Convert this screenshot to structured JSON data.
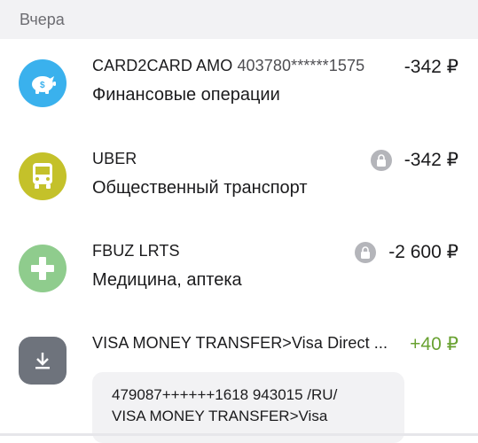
{
  "date_header": "Вчера",
  "colors": {
    "finance": "#3ab1ed",
    "transport": "#c4c12a",
    "medicine": "#8fcc8d",
    "transfer": "#6e737c",
    "positive": "#69a232"
  },
  "transactions": [
    {
      "merchant": "CARD2CARD AMO",
      "card": "403780******1575",
      "category": "Финансовые операции",
      "amount": "-342 ₽",
      "icon": "piggy-bank-icon",
      "locked": false
    },
    {
      "merchant": "UBER",
      "category": "Общественный транспорт",
      "amount": "-342 ₽",
      "icon": "bus-icon",
      "locked": true
    },
    {
      "merchant": "FBUZ LRTS",
      "category": "Медицина, аптека",
      "amount": "-2 600 ₽",
      "icon": "plus-icon",
      "locked": true
    },
    {
      "merchant": "VISA MONEY TRANSFER>Visa Direct ...",
      "amount": "+40 ₽",
      "icon": "download-icon",
      "details_line1": "479087++++++1618 943015 /RU/",
      "details_line2": "VISA MONEY TRANSFER>Visa"
    }
  ]
}
